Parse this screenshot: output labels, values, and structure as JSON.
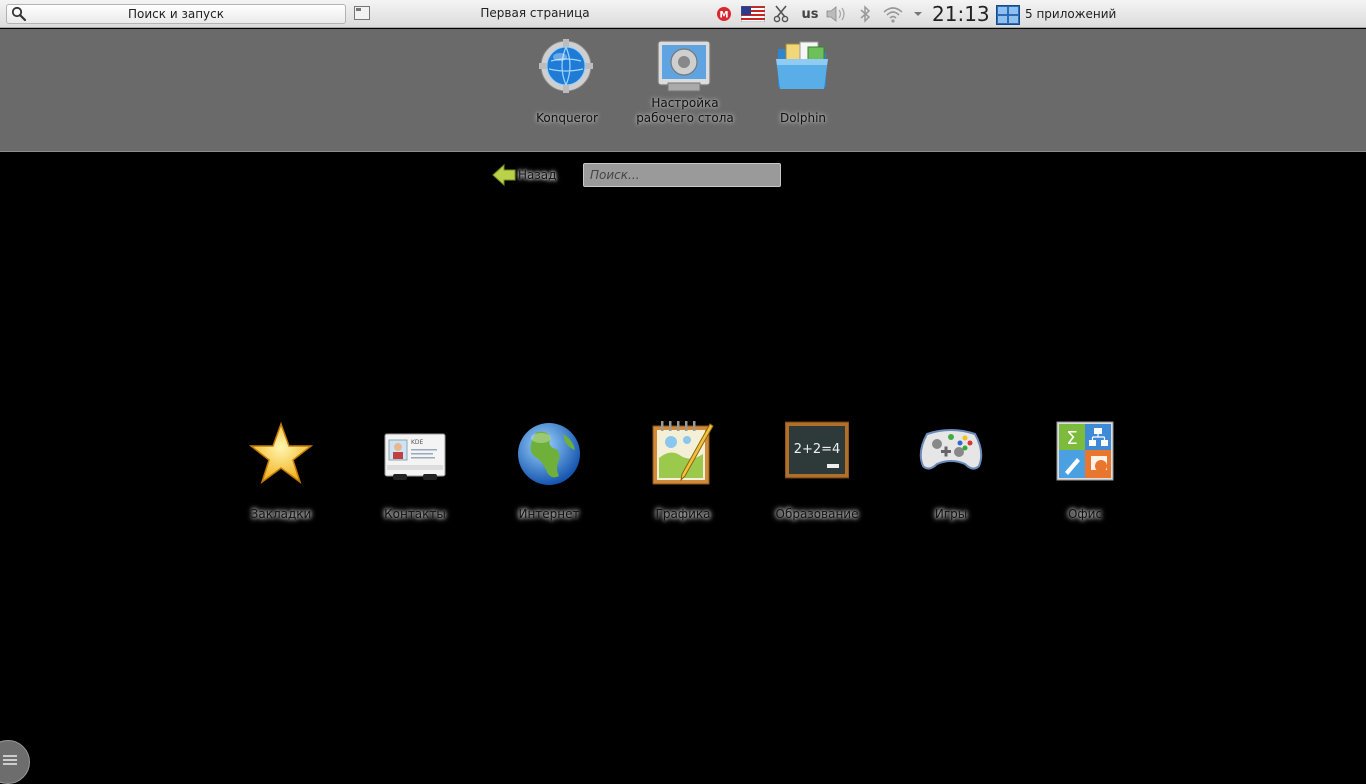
{
  "panel": {
    "search_launch_label": "Поиск и запуск",
    "page_title": "Первая страница",
    "keyboard_layout": "us",
    "clock": "21:13",
    "apps_count": "5 приложений",
    "icons": [
      "mega-icon",
      "us-flag-icon",
      "scissors-icon",
      "volume-icon",
      "bluetooth-icon",
      "wifi-icon",
      "tray-expand-icon",
      "task-manager-icon"
    ]
  },
  "favorites": [
    {
      "label": "Konqueror",
      "icon": "konqueror-icon"
    },
    {
      "label": "Настройка рабочего стола",
      "icon": "desktop-settings-icon"
    },
    {
      "label": "Dolphin",
      "icon": "dolphin-icon"
    }
  ],
  "nav": {
    "back_label": "Назад",
    "search_placeholder": "Поиск..."
  },
  "categories": [
    {
      "label": "Закладки",
      "icon": "bookmarks-star-icon"
    },
    {
      "label": "Контакты",
      "icon": "contacts-card-icon"
    },
    {
      "label": "Интернет",
      "icon": "internet-globe-icon"
    },
    {
      "label": "Графика",
      "icon": "graphics-notepad-icon"
    },
    {
      "label": "Образование",
      "icon": "education-chalkboard-icon"
    },
    {
      "label": "Игры",
      "icon": "games-gamepad-icon"
    },
    {
      "label": "Офис",
      "icon": "office-icon"
    }
  ],
  "contacts_card_text": "KDE",
  "chalkboard_text": "2+2=4",
  "colors": {
    "panel_bg": "#e8e8e8",
    "favorites_bg": "#6a6a6a",
    "workspace_bg": "#000000"
  }
}
